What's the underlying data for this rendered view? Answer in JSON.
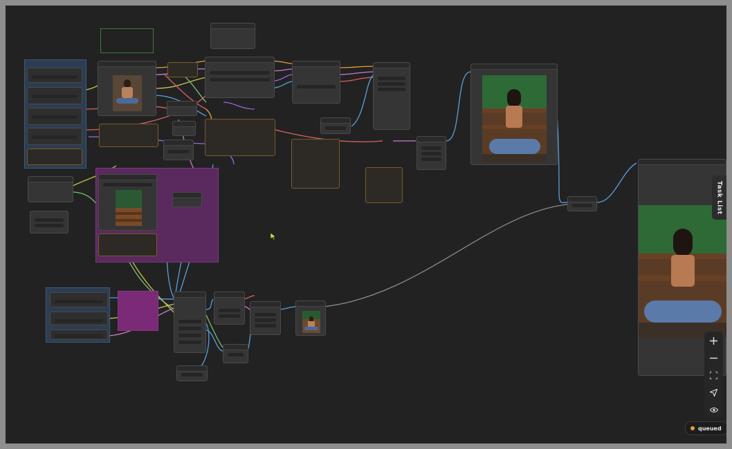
{
  "canvas": {
    "task_list_label": "Task List",
    "queue_status_label": "queued"
  },
  "toolbar": {
    "zoom_in_icon": "plus-icon",
    "zoom_out_icon": "minus-icon",
    "fit_view_icon": "fit-view-icon",
    "locate_icon": "navigate-icon",
    "toggle_visibility_icon": "eye-icon"
  },
  "colors": {
    "canvas_bg": "#222222",
    "node_bg": "#353535",
    "purple_group": "#5a2a5e",
    "blue_group": "#2c3d52",
    "magenta_group": "#7a2a76",
    "green_group_border": "#3f7a3a",
    "queued_dot": "#e0a030"
  }
}
